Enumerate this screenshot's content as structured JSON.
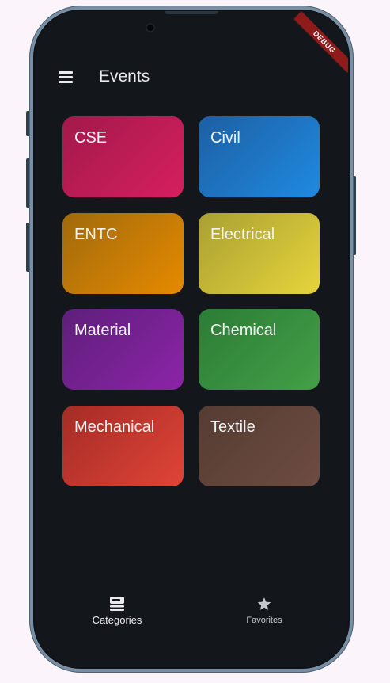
{
  "debug_banner": "DEBUG",
  "appbar": {
    "title": "Events",
    "menu_icon": "menu-icon"
  },
  "categories": [
    {
      "label": "CSE",
      "color_from": "#a2194a",
      "color_to": "#d61f5e"
    },
    {
      "label": "Civil",
      "color_from": "#1d5fa3",
      "color_to": "#1f8ae0"
    },
    {
      "label": "ENTC",
      "color_from": "#a06a0c",
      "color_to": "#e68a00"
    },
    {
      "label": "Electrical",
      "color_from": "#a9a032",
      "color_to": "#e6d43c"
    },
    {
      "label": "Material",
      "color_from": "#5e1f7a",
      "color_to": "#8c24a8"
    },
    {
      "label": "Chemical",
      "color_from": "#2c7c36",
      "color_to": "#43a047"
    },
    {
      "label": "Mechanical",
      "color_from": "#a42c26",
      "color_to": "#e04437"
    },
    {
      "label": "Textile",
      "color_from": "#553c33",
      "color_to": "#6d4c41"
    }
  ],
  "bottom_nav": {
    "categories_label": "Categories",
    "favorites_label": "Favorites",
    "categories_icon": "category-icon",
    "favorites_icon": "star-icon"
  }
}
